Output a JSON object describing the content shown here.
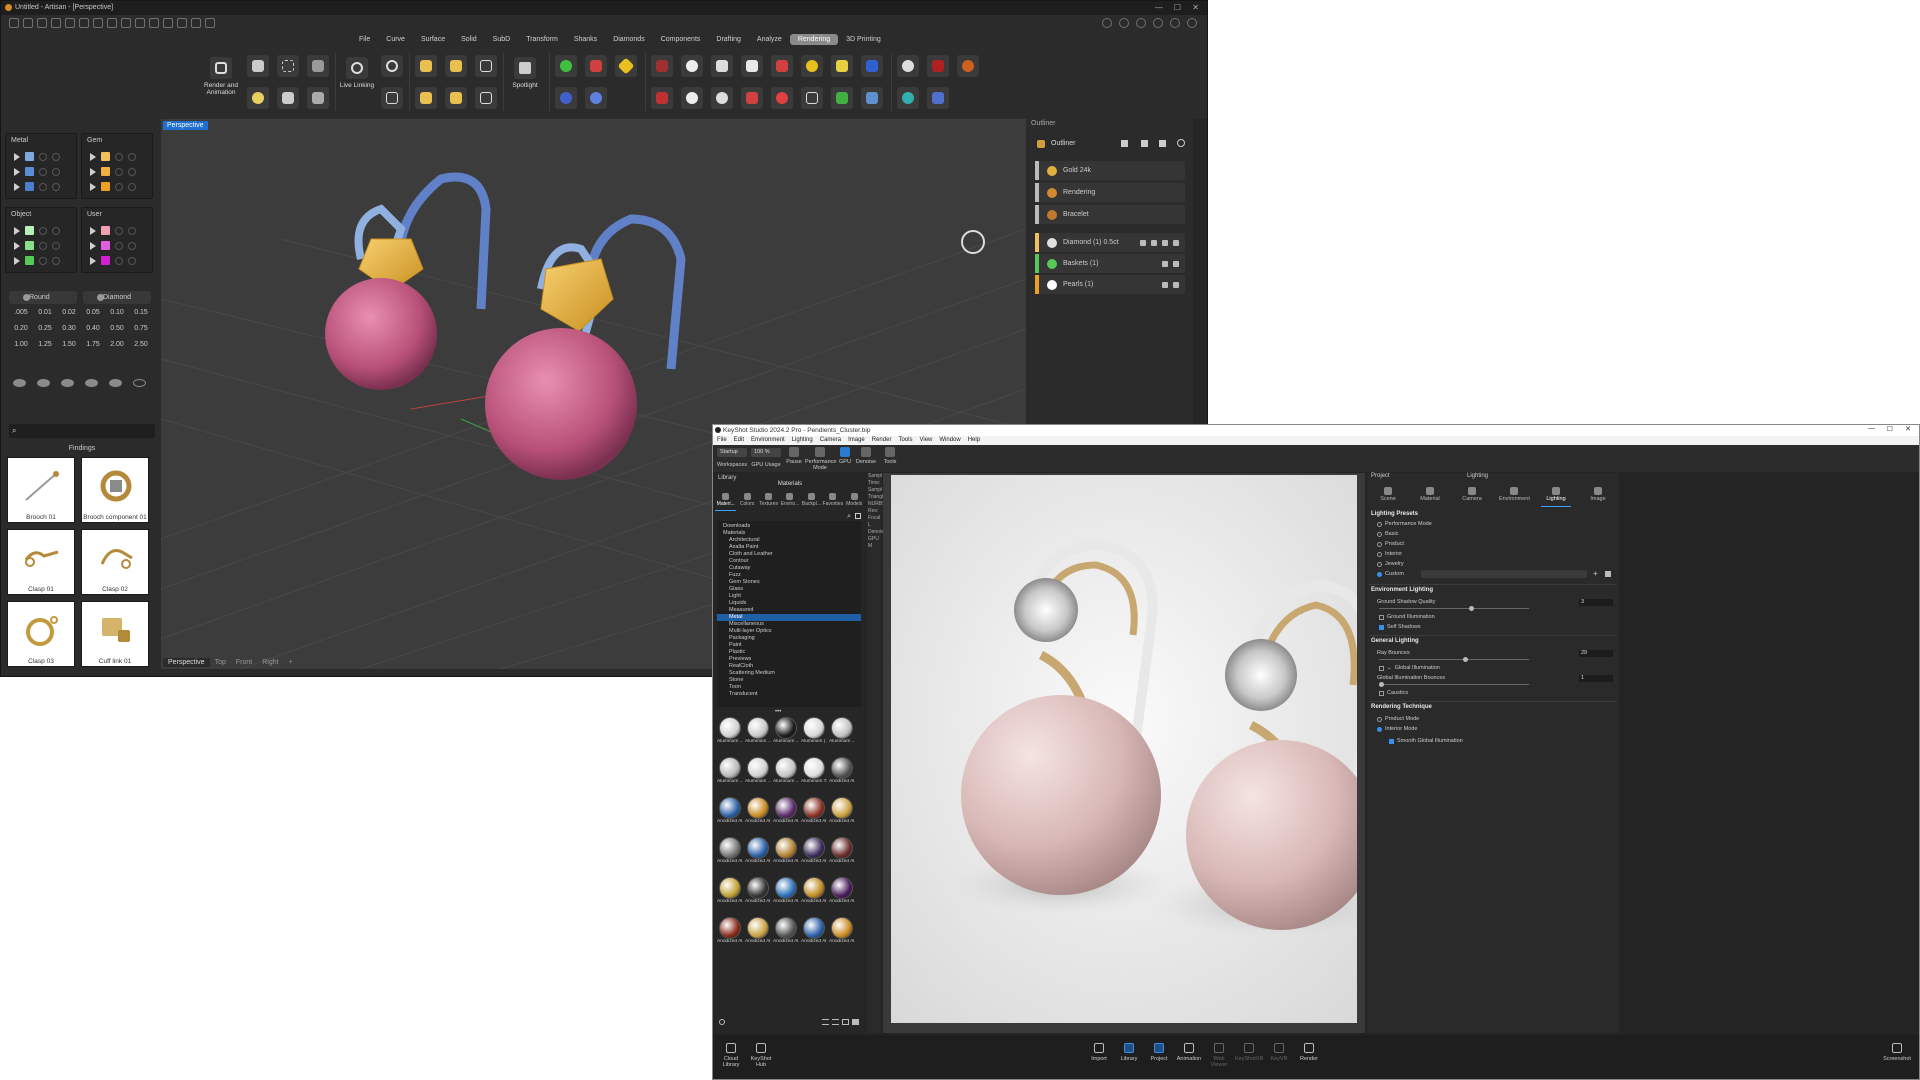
{
  "artisan": {
    "title": "Untitled - Artisan - [Perspective]",
    "menu_tabs": [
      "File",
      "Curve",
      "Surface",
      "Solid",
      "SubD",
      "Transform",
      "Shanks",
      "Diamonds",
      "Components",
      "Drafting",
      "Analyze",
      "Rendering",
      "3D Printing"
    ],
    "active_tab": "Rendering",
    "ribbon": {
      "render_animation": "Render and Animation",
      "live_linking": "Live Linking",
      "spotlight": "Spotlight"
    },
    "layers": {
      "metal": "Metal",
      "gem": "Gem",
      "object": "Object",
      "user": "User"
    },
    "layer_colors": {
      "metal": [
        "#7fa8e0",
        "#5a8fd8",
        "#4a7fd0"
      ],
      "gem": [
        "#f0c060",
        "#f0b040",
        "#f0a020"
      ],
      "object": [
        "#b8f0b8",
        "#88e088",
        "#58c858"
      ],
      "user": [
        "#f0a0b0",
        "#e060e0",
        "#d020d0"
      ]
    },
    "shape_buttons": {
      "round": "Round",
      "diamond": "Diamond"
    },
    "sizes": [
      ".005",
      "0.01",
      "0.02",
      "0.05",
      "0.10",
      "0.15",
      "0.20",
      "0.25",
      "0.30",
      "0.40",
      "0.50",
      "0.75",
      "1.00",
      "1.25",
      "1.50",
      "1.75",
      "2.00",
      "2.50"
    ],
    "findings_label": "Findings",
    "findings": [
      "Brooch 01",
      "Brooch component 01",
      "Clasp 01",
      "Clasp 02",
      "Clasp 03",
      "Cuff link 01"
    ],
    "viewport_label": "Perspective",
    "view_tabs": [
      "Perspective",
      "Top",
      "Front",
      "Right"
    ],
    "view_tab_add": "+",
    "outliner": {
      "panel_label": "Outliner",
      "title": "Outliner",
      "materials": [
        {
          "label": "Gold 24k",
          "color": "#e0b040"
        },
        {
          "label": "Rendering",
          "color": "#d08a30"
        },
        {
          "label": "Bracelet",
          "color": "#c07a30"
        }
      ],
      "objects": [
        {
          "label": "Diamond (1) 0.5ct",
          "bar": "#f0c060",
          "dot": "#e0e0e0"
        },
        {
          "label": "Baskets (1)",
          "bar": "#58c858",
          "dot": "#58c858"
        },
        {
          "label": "Pearls (1)",
          "bar": "#f0a020",
          "dot": "#ffffff"
        }
      ]
    }
  },
  "keyshot": {
    "title": "KeyShot Studio 2024.2 Pro - Pendients_Cluster.bip",
    "menus": [
      "File",
      "Edit",
      "Environment",
      "Lighting",
      "Camera",
      "Image",
      "Render",
      "Tools",
      "View",
      "Window",
      "Help"
    ],
    "toolbar": {
      "workspace_value": "Startup",
      "zoom_value": "100 %",
      "items": [
        "Workspaces",
        "GPU Usage",
        "Pause",
        "Performance Mode",
        "GPU",
        "Denoise",
        "Tools"
      ]
    },
    "library": {
      "label": "Library",
      "header": "Materials",
      "tabs": [
        "Materi...",
        "Colors",
        "Textures",
        "Enviro...",
        "Backpl...",
        "Favorites",
        "Models"
      ],
      "tree": [
        "Downloads",
        "Materials",
        "Architectural",
        "Axalta Paint",
        "Cloth and Leather",
        "Contour",
        "Cutaway",
        "Fuzz",
        "Gem Stones",
        "Glass",
        "Light",
        "Liquids",
        "Measured",
        "Metal",
        "Miscellaneous",
        "Multi-layer Optics",
        "Packaging",
        "Paint",
        "Plastic",
        "Previews",
        "RealCloth",
        "Scattering Medium",
        "Stone",
        "Toon",
        "Translucent"
      ],
      "selected": "Metal",
      "thumb_labels": [
        "Aluminum ...",
        "Aluminum ...",
        "Aluminum ...",
        "Aluminum (...",
        "Aluminum ...",
        "Aluminum ...",
        "Aluminum ...",
        "Aluminum ...",
        "Aluminum T...",
        "Anodized Al...",
        "Anodized Al...",
        "Anodized Al...",
        "Anodized Al...",
        "Anodized Al...",
        "Anodized Al...",
        "Anodized Al...",
        "Anodized Al...",
        "Anodized Al...",
        "Anodized Al...",
        "Anodized Al...",
        "Anodized Al...",
        "Anodized Al...",
        "Anodized Al...",
        "Anodized Al...",
        "Anodized Al...",
        "Anodized Al...",
        "Anodized Al...",
        "Anodized Al...",
        "Anodized Al...",
        "Anodized Al..."
      ],
      "thumb_colors": [
        "#d0d0d0",
        "#c8c8c8",
        "#1a1a1a",
        "#d8d8d8",
        "#c0c0c0",
        "#b8b8b8",
        "#cfcfcf",
        "#c4c4c4",
        "#dcdcdc",
        "#555555",
        "#2a5fa8",
        "#c98a20",
        "#5a2a6a",
        "#8a3020",
        "#c9a040",
        "#777777",
        "#2a5fa8",
        "#b08030",
        "#3a2a5a",
        "#6a2a2a",
        "#c0a030",
        "#333333",
        "#2a6fb8",
        "#c08a20",
        "#4a1a5a",
        "#8a2a1a",
        "#c9a040",
        "#555555",
        "#2a5fa8",
        "#c98a20"
      ]
    },
    "side_info": [
      "Sampl",
      "Time:",
      "Sampl",
      "Triangl",
      "NURBS",
      "Res:",
      "Focal L",
      "Denois",
      "GPU M"
    ],
    "project": {
      "label": "Project",
      "header": "Lighting",
      "tabs": [
        "Scene",
        "Material",
        "Camera",
        "Environment",
        "Lighting",
        "Image"
      ],
      "lighting_presets_title": "Lighting Presets",
      "presets": [
        "Performance Mode",
        "Basic",
        "Product",
        "Interior",
        "Jewelry",
        "Custom"
      ],
      "selected_preset": "Custom",
      "env_lighting_title": "Environment Lighting",
      "ground_shadow_quality_label": "Ground Shadow Quality",
      "ground_shadow_quality_value": "3",
      "ground_illumination": "Ground Illumination",
      "self_shadows": "Self Shadows",
      "general_lighting_title": "General Lighting",
      "ray_bounces_label": "Ray Bounces",
      "ray_bounces_value": "29",
      "global_illumination": "Global Illumination",
      "gi_bounces_label": "Global Illumination Bounces",
      "gi_bounces_value": "1",
      "caustics": "Caustics",
      "rendering_technique_title": "Rendering Technique",
      "product_mode": "Product Mode",
      "interior_mode": "Interior Mode",
      "smooth_gi": "Smooth Global Illumination"
    },
    "bottom": {
      "cloud_library": "Cloud Library",
      "keyshot_hub": "KeyShot Hub",
      "items": [
        "Import",
        "Library",
        "Project",
        "Animation",
        "Web Viewer",
        "KeyShotXR",
        "KeyVR",
        "Render"
      ],
      "screenshot": "Screenshot",
      "active": [
        "Library",
        "Project"
      ],
      "dim": [
        "Web Viewer",
        "KeyShotXR",
        "KeyVR"
      ]
    }
  }
}
